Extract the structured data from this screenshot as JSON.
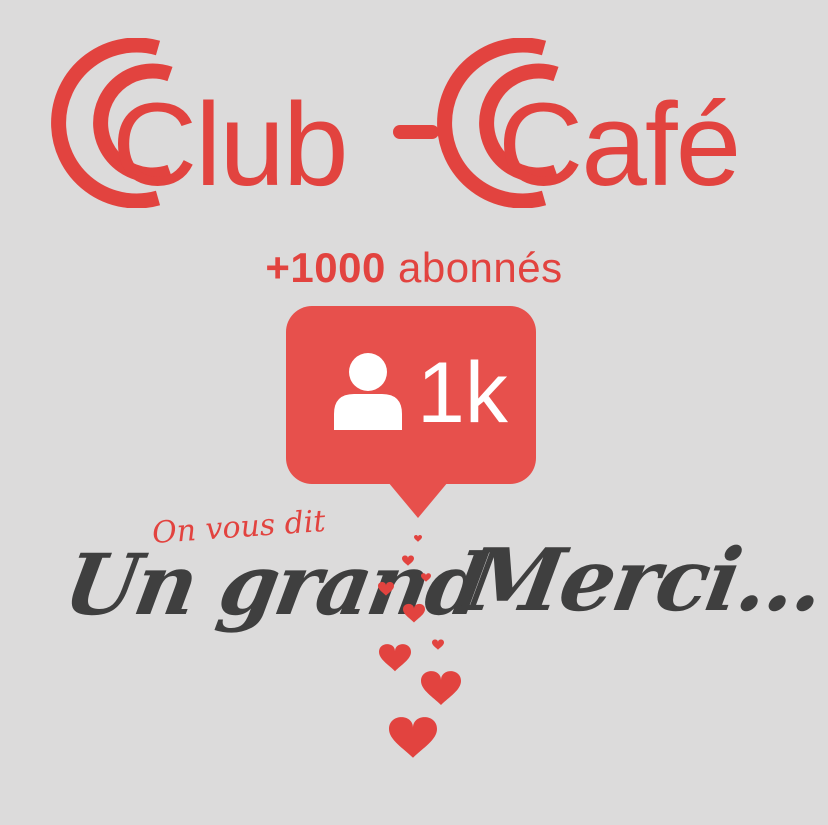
{
  "logo": {
    "word1": "Club",
    "word2": "Café",
    "color": "#e2433f"
  },
  "followers": {
    "number": "+1000",
    "label": " abonnés"
  },
  "notification": {
    "icon": "user-icon",
    "count": "1k",
    "color": "#e7504c"
  },
  "message": {
    "intro": "On vous dit",
    "part1": "Un grand",
    "part2": "Merci..."
  },
  "decor": {
    "icon": "heart-icon",
    "color": "#e2433f"
  }
}
